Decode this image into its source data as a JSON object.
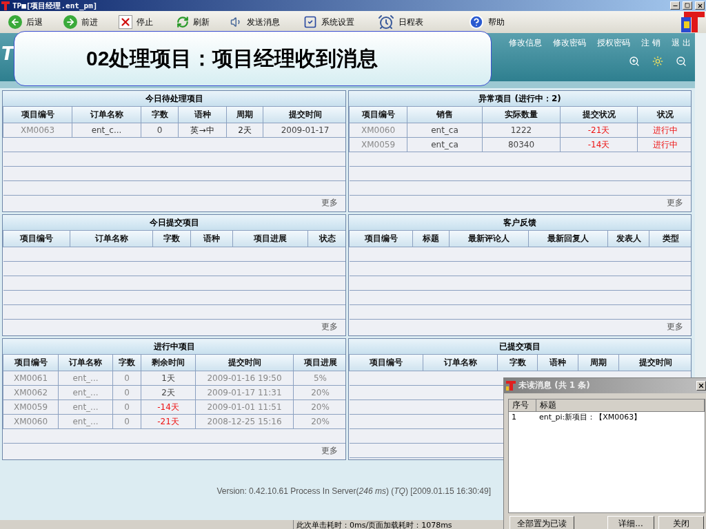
{
  "window": {
    "title": "TP■[项目经理.ent_pm]"
  },
  "toolbar": [
    {
      "kind": "back",
      "label": "后退"
    },
    {
      "kind": "forward",
      "label": "前进"
    },
    {
      "kind": "stop",
      "label": "停止"
    },
    {
      "kind": "refresh",
      "label": "刷新"
    },
    {
      "kind": "message",
      "label": "发送消息"
    },
    {
      "kind": "settings",
      "label": "系统设置"
    },
    {
      "kind": "calendar",
      "label": "日程表"
    },
    {
      "kind": "help",
      "label": "帮助"
    }
  ],
  "header": {
    "logo": "T",
    "links": [
      "修改信息",
      "修改密码",
      "授权密码",
      "注 销",
      "退 出"
    ]
  },
  "callout": "02处理项目：项目经理收到消息",
  "panels": [
    {
      "title": "今日待处理项目",
      "columns": [
        {
          "label": "项目编号",
          "kind": "id"
        },
        {
          "label": "订单名称",
          "kind": "text"
        },
        {
          "label": "字数",
          "kind": "text"
        },
        {
          "label": "语种",
          "kind": "plain"
        },
        {
          "label": "周期",
          "kind": "plain"
        },
        {
          "label": "提交时间",
          "kind": "text"
        }
      ],
      "rows": [
        {
          "cells": [
            "XM0063",
            "ent_c...",
            "0",
            "英→中",
            "2天",
            "2009-01-17"
          ]
        }
      ],
      "more": "更多"
    },
    {
      "title": "异常项目 (进行中：2)",
      "columns": [
        {
          "label": "项目编号",
          "kind": "id"
        },
        {
          "label": "销售",
          "kind": "text"
        },
        {
          "label": "实际数量",
          "kind": "text"
        },
        {
          "label": "提交状况",
          "kind": "deadline"
        },
        {
          "label": "状况",
          "kind": "deadline"
        }
      ],
      "rows": [
        {
          "cells": [
            "XM0060",
            "ent_ca",
            "1222",
            "-21天",
            "进行中"
          ],
          "overdue": true
        },
        {
          "cells": [
            "XM0059",
            "ent_ca",
            "80340",
            "-14天",
            "进行中"
          ],
          "overdue": true
        }
      ],
      "more": "更多"
    },
    {
      "title": "今日提交项目",
      "columns": [
        {
          "label": "项目编号"
        },
        {
          "label": "订单名称"
        },
        {
          "label": "字数"
        },
        {
          "label": "语种"
        },
        {
          "label": "项目进展"
        },
        {
          "label": "状态"
        }
      ],
      "more": "更多"
    },
    {
      "title": "客户反馈",
      "columns": [
        {
          "label": "项目编号"
        },
        {
          "label": "标题"
        },
        {
          "label": "最新评论人"
        },
        {
          "label": "最新回复人"
        },
        {
          "label": "发表人"
        },
        {
          "label": "类型"
        }
      ],
      "more": "更多"
    },
    {
      "title": "进行中项目",
      "columns": [
        {
          "label": "项目编号",
          "kind": "id"
        },
        {
          "label": "订单名称",
          "kind": "id"
        },
        {
          "label": "字数",
          "kind": "id"
        },
        {
          "label": "剩余时间",
          "kind": "deadline"
        },
        {
          "label": "提交时间",
          "kind": "id"
        },
        {
          "label": "项目进展",
          "kind": "id"
        }
      ],
      "rows": [
        {
          "cells": [
            "XM0061",
            "ent_...",
            "0",
            "1天",
            "2009-01-16 19:50",
            "5%"
          ],
          "overdue": false
        },
        {
          "cells": [
            "XM0062",
            "ent_...",
            "0",
            "2天",
            "2009-01-17 11:31",
            "20%"
          ],
          "overdue": false
        },
        {
          "cells": [
            "XM0059",
            "ent_...",
            "0",
            "-14天",
            "2009-01-01 11:51",
            "20%"
          ],
          "overdue": true
        },
        {
          "cells": [
            "XM0060",
            "ent_...",
            "0",
            "-21天",
            "2008-12-25 15:16",
            "20%"
          ],
          "overdue": true
        }
      ],
      "more": "更多"
    },
    {
      "title": "已提交项目",
      "columns": [
        {
          "label": "项目编号"
        },
        {
          "label": "订单名称"
        },
        {
          "label": "字数"
        },
        {
          "label": "语种"
        },
        {
          "label": "周期"
        },
        {
          "label": "提交时间"
        }
      ]
    }
  ],
  "version": "Version: 0.42.10.61 Process In Server(*246 ms*) (*TQ*) [2009.01.15 16:30:49]",
  "status_bar": "此次单击耗时：0ms/页面加载耗时：1078ms",
  "popup": {
    "title": "未读消息 (共 1 条)",
    "columns": [
      "序号",
      "标题"
    ],
    "messages": [
      {
        "index": "1",
        "title": "ent_pi:新项目：【XM0063】"
      }
    ],
    "buttons": [
      "全部置为已读",
      "详细...",
      "关闭"
    ]
  }
}
